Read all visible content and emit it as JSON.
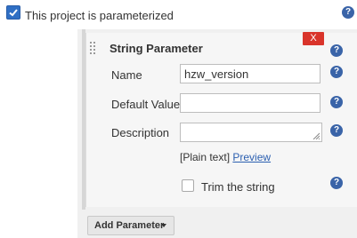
{
  "header": {
    "parameterized_label": "This project is parameterized",
    "parameterized_checked": true
  },
  "parameter": {
    "title": "String Parameter",
    "close_label": "X",
    "name_label": "Name",
    "name_value": "hzw_version",
    "default_label": "Default Value",
    "default_value": "",
    "description_label": "Description",
    "description_value": "",
    "plain_text": "[Plain text]",
    "preview_link": "Preview",
    "trim_label": "Trim the string",
    "trim_checked": false
  },
  "help_icon_text": "?",
  "footer": {
    "add_parameter_label": "Add Parameter"
  },
  "colors": {
    "accent": "#2f6fc4",
    "close": "#d9342b",
    "link": "#2b5fb0",
    "help": "#3a64a8"
  }
}
